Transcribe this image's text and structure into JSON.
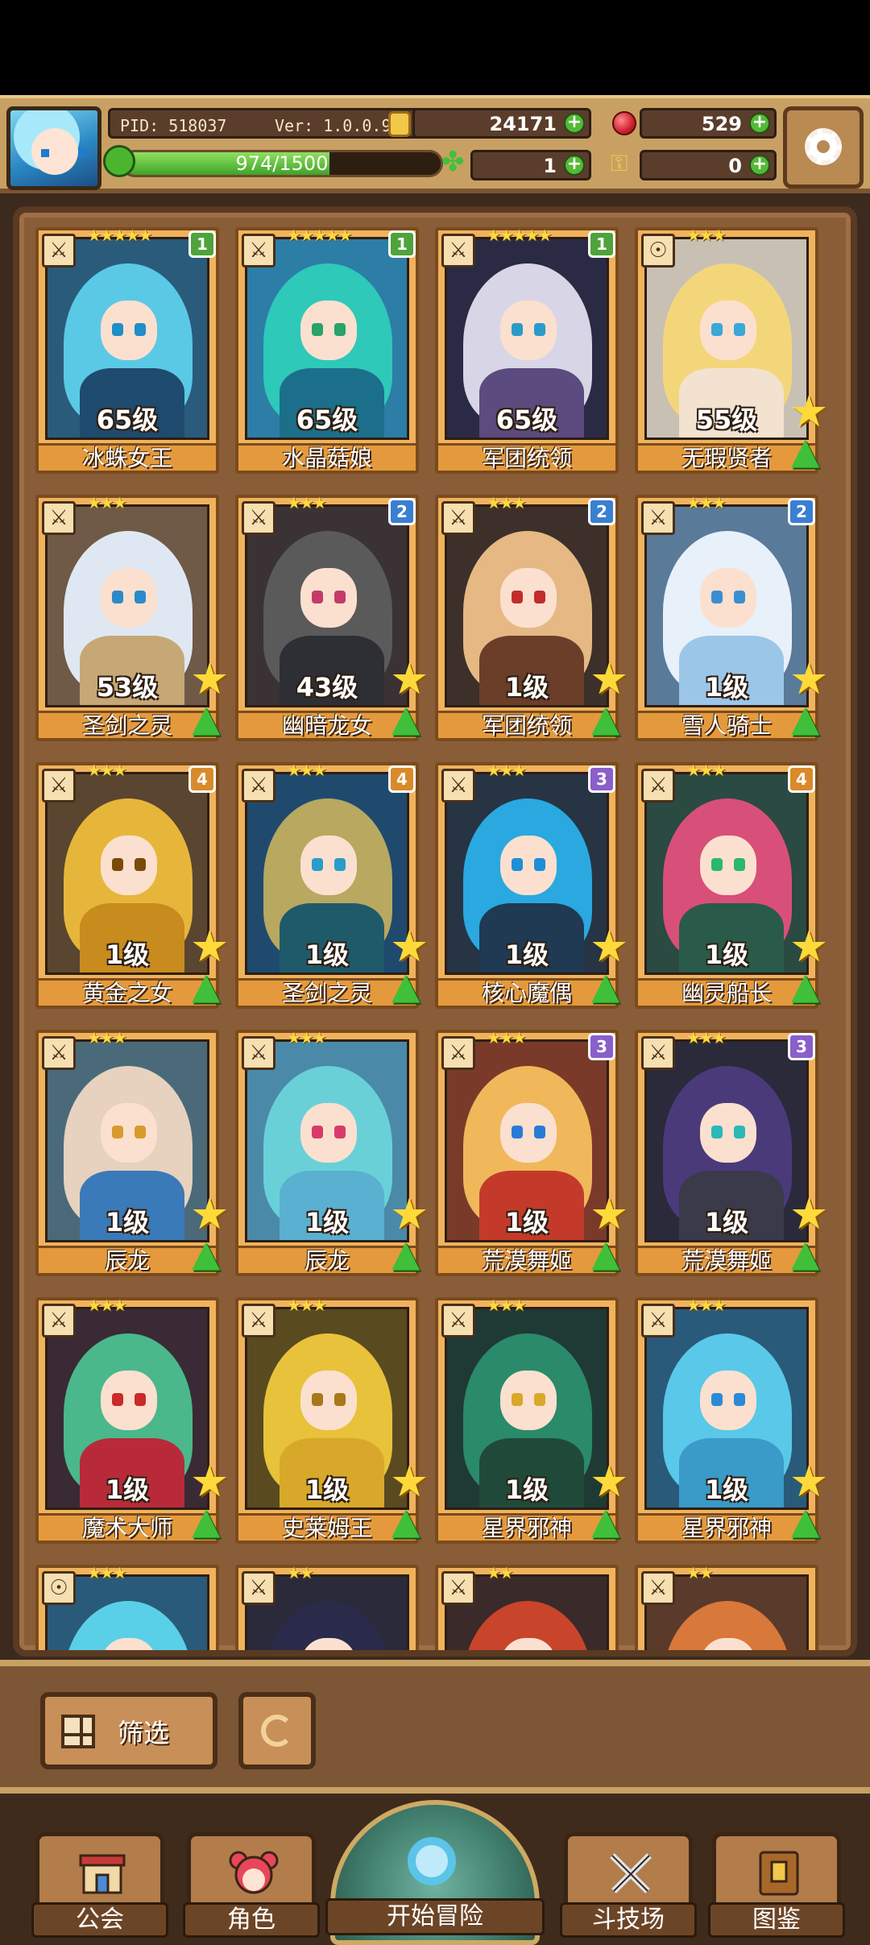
{
  "header": {
    "pid": "PID: 518037",
    "version": "Ver: 1.0.0.9",
    "gold": "24171",
    "gems": "529",
    "clover": "1",
    "keys": "0",
    "xp_text": "974/1500",
    "xp_progress": 0.649
  },
  "roster": [
    {
      "name": "冰蛛女王",
      "level": "65级",
      "stars": "★★★★★",
      "badge": "1",
      "badge_color": "#4fa33a",
      "hair": "#5ac9e6",
      "body": "#1e4b6e",
      "eye": "#1f8ec9",
      "bg": "#2a5b7a",
      "star_up": false
    },
    {
      "name": "水晶菇娘",
      "level": "65级",
      "stars": "★★★★★",
      "badge": "1",
      "badge_color": "#4fa33a",
      "hair": "#2ec9b8",
      "body": "#1b6f8a",
      "eye": "#27a36b",
      "bg": "#2c7ea6",
      "star_up": false
    },
    {
      "name": "军团统领",
      "level": "65级",
      "stars": "★★★★★",
      "badge": "1",
      "badge_color": "#4fa33a",
      "hair": "#d8d6e6",
      "body": "#5b4b7e",
      "eye": "#2a9bc9",
      "bg": "#2a2a45",
      "star_up": false
    },
    {
      "name": "无瑕贤者",
      "level": "55级",
      "stars": "★★★",
      "badge": "",
      "badge_color": "",
      "hair": "#f4d67a",
      "body": "#f2e2cf",
      "eye": "#38a8d8",
      "bg": "#c9c0b4",
      "star_up": true
    },
    {
      "name": "圣剑之灵",
      "level": "53级",
      "stars": "★★★",
      "badge": "",
      "badge_color": "",
      "hair": "#dfe8f2",
      "body": "#c6a876",
      "eye": "#2b8ac9",
      "bg": "#6f5a48",
      "star_up": true
    },
    {
      "name": "幽暗龙女",
      "level": "43级",
      "stars": "★★★",
      "badge": "2",
      "badge_color": "#3a7fd1",
      "hair": "#5a5a5a",
      "body": "#2e2e35",
      "eye": "#c43b6a",
      "bg": "#3a3235",
      "star_up": true
    },
    {
      "name": "军团统领",
      "level": "1级",
      "stars": "★★★",
      "badge": "2",
      "badge_color": "#3a7fd1",
      "hair": "#e6b884",
      "body": "#6b3e2a",
      "eye": "#c22c2c",
      "bg": "#3d2f2a",
      "star_up": true
    },
    {
      "name": "雪人骑士",
      "level": "1级",
      "stars": "★★★",
      "badge": "2",
      "badge_color": "#3a7fd1",
      "hair": "#e8f0fa",
      "body": "#9cc6e8",
      "eye": "#3a8fd0",
      "bg": "#5a7a9a",
      "star_up": true
    },
    {
      "name": "黄金之女",
      "level": "1级",
      "stars": "★★★",
      "badge": "4",
      "badge_color": "#d98a2a",
      "hair": "#e6b63a",
      "body": "#c88b1e",
      "eye": "#7a4a0a",
      "bg": "#5a4530",
      "star_up": true
    },
    {
      "name": "圣剑之灵",
      "level": "1级",
      "stars": "★★★",
      "badge": "4",
      "badge_color": "#d98a2a",
      "hair": "#b8a860",
      "body": "#1f5a6a",
      "eye": "#2a9cc9",
      "bg": "#1f4a6e",
      "star_up": true
    },
    {
      "name": "核心魔偶",
      "level": "1级",
      "stars": "★★★",
      "badge": "3",
      "badge_color": "#8a5fc9",
      "hair": "#2aa8e0",
      "body": "#1f3a52",
      "eye": "#1f8ed8",
      "bg": "#263444",
      "star_up": true
    },
    {
      "name": "幽灵船长",
      "level": "1级",
      "stars": "★★★",
      "badge": "4",
      "badge_color": "#d98a2a",
      "hair": "#d84f7a",
      "body": "#2a5a4a",
      "eye": "#2ab86a",
      "bg": "#2a4a42",
      "star_up": true
    },
    {
      "name": "辰龙",
      "level": "1级",
      "stars": "★★★",
      "badge": "",
      "badge_color": "",
      "hair": "#e6d2be",
      "body": "#3a7ab8",
      "eye": "#d89a2a",
      "bg": "#4a6a7a",
      "star_up": true
    },
    {
      "name": "辰龙",
      "level": "1级",
      "stars": "★★★",
      "badge": "",
      "badge_color": "",
      "hair": "#6ad0d8",
      "body": "#5ab0d0",
      "eye": "#d83a6a",
      "bg": "#4a8aa8",
      "star_up": true
    },
    {
      "name": "荒漠舞姬",
      "level": "1级",
      "stars": "★★★",
      "badge": "3",
      "badge_color": "#8a5fc9",
      "hair": "#f0b85a",
      "body": "#c43a2a",
      "eye": "#2a7ad8",
      "bg": "#7a3a2a",
      "star_up": true
    },
    {
      "name": "荒漠舞姬",
      "level": "1级",
      "stars": "★★★",
      "badge": "3",
      "badge_color": "#8a5fc9",
      "hair": "#4a3a7a",
      "body": "#3a3a4a",
      "eye": "#2ab8b8",
      "bg": "#2a2a3a",
      "star_up": true
    },
    {
      "name": "魔术大师",
      "level": "1级",
      "stars": "★★★",
      "badge": "",
      "badge_color": "",
      "hair": "#4ab88a",
      "body": "#b82a3a",
      "eye": "#c92a2a",
      "bg": "#3a2a35",
      "star_up": true
    },
    {
      "name": "史莱姆王",
      "level": "1级",
      "stars": "★★★",
      "badge": "",
      "badge_color": "",
      "hair": "#e8c23a",
      "body": "#d8a82a",
      "eye": "#a8781a",
      "bg": "#5a4a20",
      "star_up": true
    },
    {
      "name": "星界邪神",
      "level": "1级",
      "stars": "★★★",
      "badge": "",
      "badge_color": "",
      "hair": "#2a8a6a",
      "body": "#1f4a3a",
      "eye": "#d8a82a",
      "bg": "#1f3a34",
      "star_up": true
    },
    {
      "name": "星界邪神",
      "level": "1级",
      "stars": "★★★",
      "badge": "",
      "badge_color": "",
      "hair": "#5ac8e8",
      "body": "#3a9ac8",
      "eye": "#2a8ad8",
      "bg": "#2a5a7a",
      "star_up": true
    },
    {
      "name": "",
      "level": "",
      "stars": "★★★",
      "badge": "",
      "badge_color": "",
      "hair": "#5ad0e8",
      "body": "#3a9ac8",
      "eye": "#2a8ad8",
      "bg": "#2a5a7a",
      "star_up": false
    },
    {
      "name": "",
      "level": "",
      "stars": "★★",
      "badge": "",
      "badge_color": "",
      "hair": "#2a2a4a",
      "body": "#3a8a4a",
      "eye": "#d8a82a",
      "bg": "#2a2a3a",
      "star_up": false
    },
    {
      "name": "",
      "level": "",
      "stars": "★★",
      "badge": "",
      "badge_color": "",
      "hair": "#c8442a",
      "body": "#5a2a2a",
      "eye": "#d8a82a",
      "bg": "#3a2a2a",
      "star_up": false
    },
    {
      "name": "",
      "level": "",
      "stars": "★★",
      "badge": "",
      "badge_color": "",
      "hair": "#d8783a",
      "body": "#c8683a",
      "eye": "#2a7ad8",
      "bg": "#5a3a2a",
      "star_up": false
    }
  ],
  "controls": {
    "filter_label": "筛选"
  },
  "nav": {
    "guild": "公会",
    "character": "角色",
    "start": "开始冒险",
    "arena": "斗技场",
    "codex": "图鉴"
  }
}
